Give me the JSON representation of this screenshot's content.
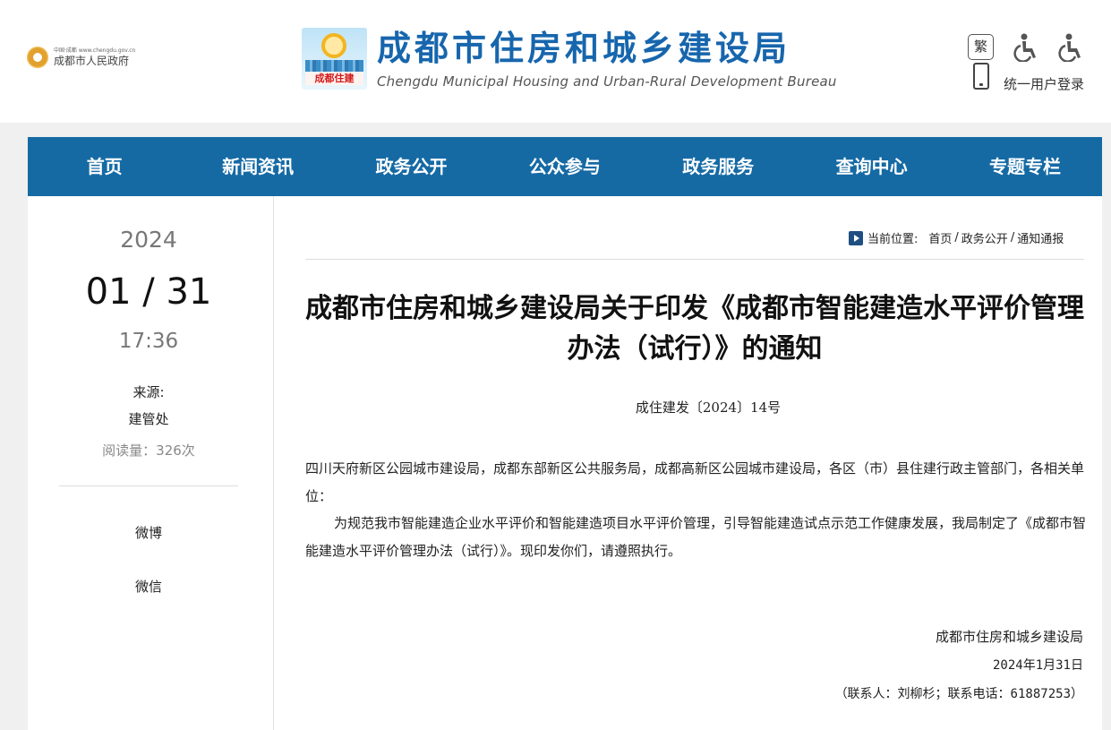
{
  "header": {
    "gov_small": "中国·成都 www.chengdu.gov.cn",
    "gov_name": "成都市人民政府",
    "bureau_tag": "成都住建",
    "bureau_name_cn": "成都市住房和城乡建设局",
    "bureau_name_en": "Chengdu Municipal Housing and Urban-Rural Development Bureau",
    "traditional_label": "繁",
    "icons": [
      "accessibility-icon",
      "accessibility-icon",
      "mobile-icon"
    ],
    "login_label": "统一用户登录"
  },
  "nav": {
    "items": [
      {
        "label": "首页"
      },
      {
        "label": "新闻资讯"
      },
      {
        "label": "政务公开"
      },
      {
        "label": "公众参与"
      },
      {
        "label": "政务服务"
      },
      {
        "label": "查询中心"
      },
      {
        "label": "专题专栏"
      }
    ],
    "color": "#156aa4"
  },
  "sidebar": {
    "year": "2024",
    "date": "01 / 31",
    "time": "17:36",
    "source_label": "来源:",
    "source": "建管处",
    "reads": "阅读量：326次",
    "weibo": "微博",
    "weixin": "微信"
  },
  "breadcrumb": {
    "label": "当前位置:",
    "items": [
      "首页",
      "政务公开",
      "通知通报"
    ],
    "separator": "/"
  },
  "article": {
    "title": "成都市住房和城乡建设局关于印发《成都市智能建造水平评价管理办法（试行）》的通知",
    "doc_number": "成住建发〔2024〕14号",
    "recipients": "四川天府新区公园城市建设局，成都东部新区公共服务局，成都高新区公园城市建设局，各区（市）县住建行政主管部门，各相关单位：",
    "body": "为规范我市智能建造企业水平评价和智能建造项目水平评价管理，引导智能建造试点示范工作健康发展，我局制定了《成都市智能建造水平评价管理办法（试行）》。现印发你们，请遵照执行。",
    "sign_org": "成都市住房和城乡建设局",
    "sign_date": "2024年1月31日",
    "contact": "（联系人：刘柳杉；联系电话：61887253）"
  }
}
